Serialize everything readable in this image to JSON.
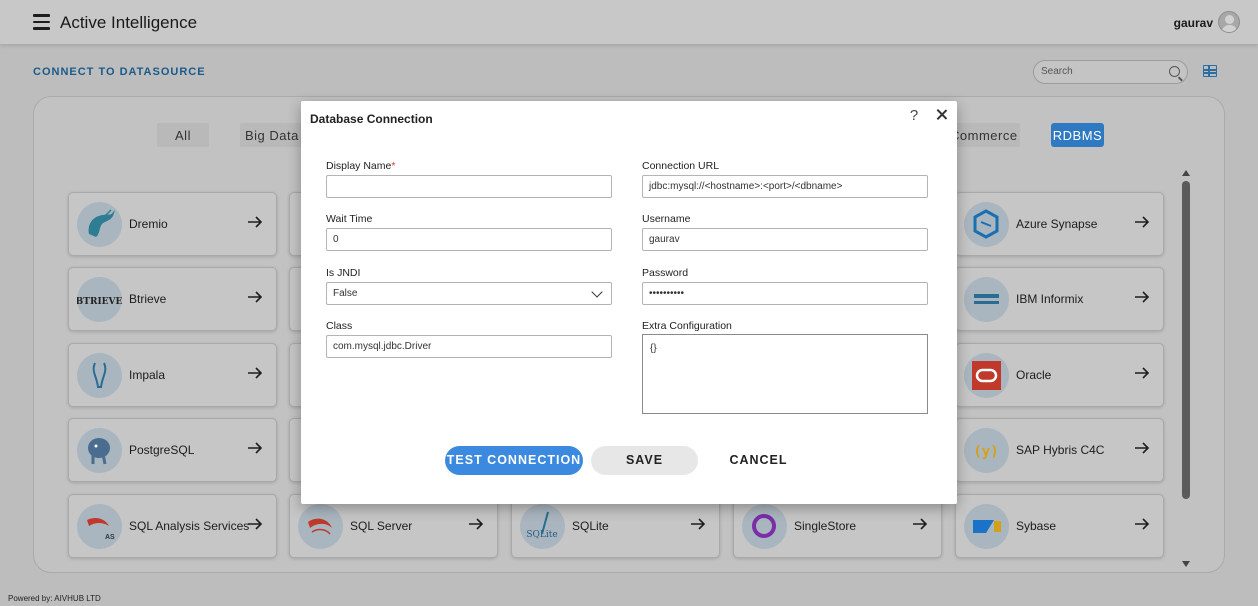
{
  "header": {
    "app_title": "Active Intelligence",
    "user_name": "gaurav"
  },
  "page": {
    "heading": "CONNECT TO DATASOURCE",
    "search_placeholder": "Search"
  },
  "filters": [
    {
      "label": "All",
      "active": false
    },
    {
      "label": "Big Data",
      "active": false
    },
    {
      "label": "Commerce",
      "active": false
    },
    {
      "label": "RDBMS",
      "active": true
    }
  ],
  "datasources": [
    {
      "name": "Dremio",
      "icon": "dremio-narwhal-icon"
    },
    {
      "name": "Azure Synapse",
      "icon": "azure-synapse-icon"
    },
    {
      "name": "Btrieve",
      "icon": "btrieve-logo-icon"
    },
    {
      "name": "IBM Informix",
      "icon": "informix-logo-icon"
    },
    {
      "name": "Impala",
      "icon": "impala-logo-icon"
    },
    {
      "name": "Oracle",
      "icon": "oracle-logo-icon"
    },
    {
      "name": "PostgreSQL",
      "icon": "postgresql-elephant-icon"
    },
    {
      "name": "SAP Hybris C4C",
      "icon": "sap-hybris-icon"
    },
    {
      "name": "SQL Analysis Services",
      "icon": "sql-analysis-services-icon"
    },
    {
      "name": "SQL Server",
      "icon": "sql-server-icon"
    },
    {
      "name": "SQLite",
      "icon": "sqlite-logo-icon"
    },
    {
      "name": "SingleStore",
      "icon": "singlestore-logo-icon"
    },
    {
      "name": "Sybase",
      "icon": "sybase-sap-icon"
    }
  ],
  "modal": {
    "title": "Database Connection",
    "help_glyph": "?",
    "fields": {
      "display_name": {
        "label": "Display Name",
        "required_mark": "*",
        "value": ""
      },
      "wait_time": {
        "label": "Wait Time",
        "value": "0"
      },
      "is_jndi": {
        "label": "Is JNDI",
        "value": "False"
      },
      "class": {
        "label": "Class",
        "value": "com.mysql.jdbc.Driver"
      },
      "connection_url": {
        "label": "Connection URL",
        "value": "jdbc:mysql://<hostname>:<port>/<dbname>"
      },
      "username": {
        "label": "Username",
        "value": "gaurav"
      },
      "password": {
        "label": "Password",
        "value": "••••••••••"
      },
      "extra_configuration": {
        "label": "Extra Configuration",
        "value": "{}"
      }
    },
    "buttons": {
      "test": "TEST CONNECTION",
      "save": "SAVE",
      "cancel": "CANCEL"
    }
  },
  "footer": {
    "powered_by": "Powered by: AIVHUB LTD"
  },
  "colors": {
    "accent": "#2f79c2",
    "primary_button": "#3b8ae0",
    "heading": "#1a5a8a"
  }
}
